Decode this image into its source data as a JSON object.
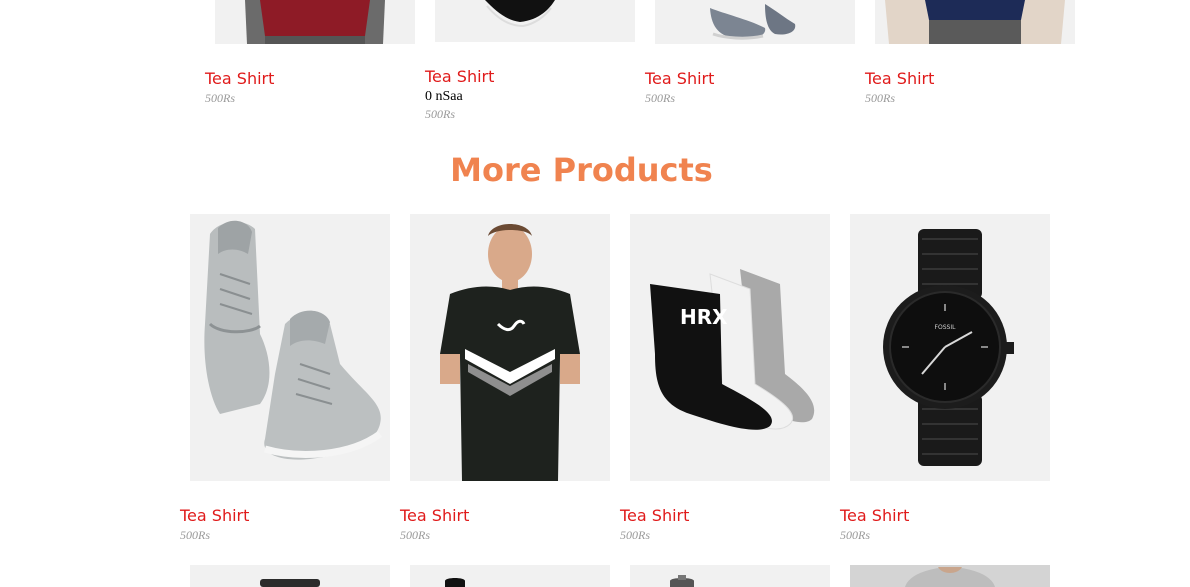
{
  "top_row": [
    {
      "name": "Tea Shirt",
      "price": "500Rs",
      "image": "maroon-tshirt"
    },
    {
      "name": "Tea Shirt",
      "tag": "0 nSaa",
      "price": "500Rs",
      "image": "black-sneaker"
    },
    {
      "name": "Tea Shirt",
      "price": "500Rs",
      "image": "grey-sneakers"
    },
    {
      "name": "Tea Shirt",
      "price": "500Rs",
      "image": "navy-tshirt"
    }
  ],
  "section_title": "More Products",
  "more_products": [
    {
      "name": "Tea Shirt",
      "price": "500Rs",
      "image": "grey-high-top-sneakers"
    },
    {
      "name": "Tea Shirt",
      "price": "500Rs",
      "image": "black-puma-tshirt"
    },
    {
      "name": "Tea Shirt",
      "price": "500Rs",
      "image": "hrx-socks"
    },
    {
      "name": "Tea Shirt",
      "price": "500Rs",
      "image": "fossil-black-watch"
    }
  ],
  "bottom_row_images": [
    "dark-item",
    "black-bottle",
    "grey-bottle",
    "grey-shirt"
  ],
  "colors": {
    "product_name": "#e01b1b",
    "section_title": "#f0834f",
    "price": "#9a9a9a",
    "thumb_bg": "#f1f1f1"
  }
}
